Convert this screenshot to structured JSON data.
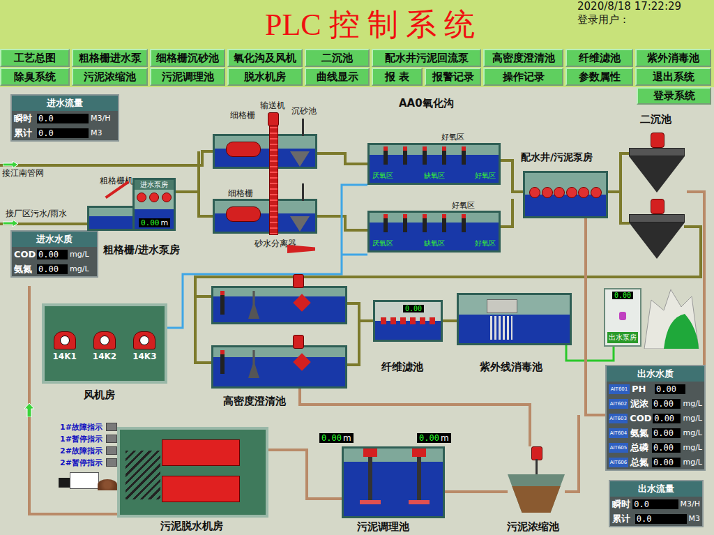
{
  "header": {
    "title": "PLC 控 制 系 统",
    "datetime": "2020/8/18 17:22:29",
    "user_label": "登录用户："
  },
  "nav_rows": [
    [
      "工艺总图",
      "粗格栅进水泵",
      "细格栅沉砂池",
      "氧化沟及风机",
      "二沉池",
      "配水井污泥回流泵",
      "高密度澄清池",
      "纤维滤池",
      "紫外消毒池"
    ],
    [
      "除臭系统",
      "污泥浓缩池",
      "污泥调理池",
      "脱水机房",
      "曲线显示",
      "报 表",
      "报警记录",
      "操作记录",
      "参数属性",
      "退出系统"
    ]
  ],
  "login_button": "登录系统",
  "inflow_panel": {
    "title": "进水流量",
    "rows": [
      {
        "label": "瞬时",
        "value": "0.0",
        "unit": "M3/H"
      },
      {
        "label": "累计",
        "value": "0.0",
        "unit": "M3"
      }
    ]
  },
  "influent_quality": {
    "title": "进水水质",
    "rows": [
      {
        "label": "COD",
        "value": "0.00",
        "unit": "mg/L"
      },
      {
        "label": "氨氮",
        "value": "0.00",
        "unit": "mg/L"
      }
    ]
  },
  "effluent_quality": {
    "title": "出水水质",
    "rows": [
      {
        "tag": "AIT601",
        "label": "PH",
        "value": "0.00",
        "unit": ""
      },
      {
        "tag": "AIT602",
        "label": "泥浓",
        "value": "0.00",
        "unit": "mg/L"
      },
      {
        "tag": "AIT603",
        "label": "COD",
        "value": "0.00",
        "unit": "mg/L"
      },
      {
        "tag": "AIT604",
        "label": "氨氮",
        "value": "0.00",
        "unit": "mg/L"
      },
      {
        "tag": "AIT605",
        "label": "总磷",
        "value": "0.00",
        "unit": "mg/L"
      },
      {
        "tag": "AIT606",
        "label": "总氮",
        "value": "0.00",
        "unit": "mg/L"
      }
    ]
  },
  "effluent_flow": {
    "title": "出水流量",
    "rows": [
      {
        "label": "瞬时",
        "value": "0.0",
        "unit": "M3/H"
      },
      {
        "label": "累计",
        "value": "0.0",
        "unit": "M3"
      }
    ]
  },
  "inlets": [
    "接江南管网",
    "接厂区污水/雨水"
  ],
  "coarse_screen": {
    "label": "粗格栅/进水泵房",
    "machine_label": "粗格栅机",
    "room_label": "进水泵房",
    "level_value": "0.00",
    "level_unit": "m"
  },
  "fine_screen": {
    "screen_labels": [
      "细格栅",
      "细格栅"
    ],
    "conveyor_label": "输送机",
    "grit_label": "沉砂池",
    "separator_label": "砂水分离器"
  },
  "oxidation_ditch": {
    "label": "AA0氧化沟",
    "zone_titles": [
      "好氧区",
      "好氧区"
    ],
    "zones": [
      "厌氧区",
      "缺氧区",
      "好氧区"
    ]
  },
  "distribution_well": {
    "label": "配水井/污泥泵房"
  },
  "secondary_clarifier": {
    "label": "二沉池"
  },
  "blower_room": {
    "label": "风机房",
    "blowers": [
      "14K1",
      "14K2",
      "14K3"
    ]
  },
  "hd_clarifier": {
    "label": "高密度澄清池"
  },
  "fiber_filter": {
    "label": "纤维滤池",
    "reading": "0.00"
  },
  "uv_disinfection": {
    "label": "紫外线消毒池"
  },
  "effluent_pump": {
    "label": "出水泵房",
    "reading": "0.00"
  },
  "dewatering": {
    "label": "污泥脱水机房",
    "indicators": [
      {
        "label": "1#故障指示",
        "on": false
      },
      {
        "label": "1#暂停指示",
        "on": false
      },
      {
        "label": "2#故障指示",
        "on": false
      },
      {
        "label": "2#暂停指示",
        "on": false
      }
    ]
  },
  "conditioning": {
    "label": "污泥调理池",
    "levels": [
      {
        "value": "0.00",
        "unit": "m"
      },
      {
        "value": "0.00",
        "unit": "m"
      }
    ]
  },
  "thickener": {
    "label": "污泥浓缩池"
  }
}
